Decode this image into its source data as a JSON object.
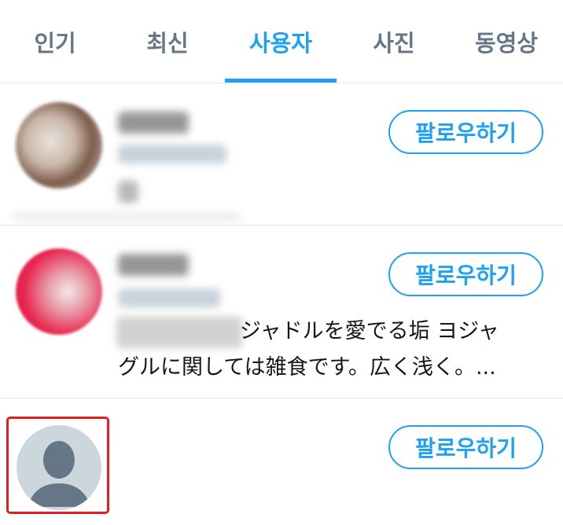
{
  "tabs": [
    {
      "label": "인기",
      "active": false
    },
    {
      "label": "최신",
      "active": false
    },
    {
      "label": "사용자",
      "active": true
    },
    {
      "label": "사진",
      "active": false
    },
    {
      "label": "동영상",
      "active": false
    }
  ],
  "users": [
    {
      "avatar": "blurred-photo",
      "follow_label": "팔로우하기",
      "bio_line1": "",
      "bio_line2": ""
    },
    {
      "avatar": "blurred-photo",
      "follow_label": "팔로우하기",
      "bio_line1": "ジャドルを愛でる垢 ヨジャ",
      "bio_line2": "グルに関しては雑食です。広く浅く。..."
    },
    {
      "avatar": "default-user-icon",
      "follow_label": "팔로우하기"
    }
  ],
  "colors": {
    "accent": "#1da1f2",
    "tab_inactive": "#657786",
    "divider": "#e1e8ed",
    "highlight": "#e02020",
    "default_avatar_bg": "#ccd6dd",
    "default_avatar_fg": "#657786"
  }
}
